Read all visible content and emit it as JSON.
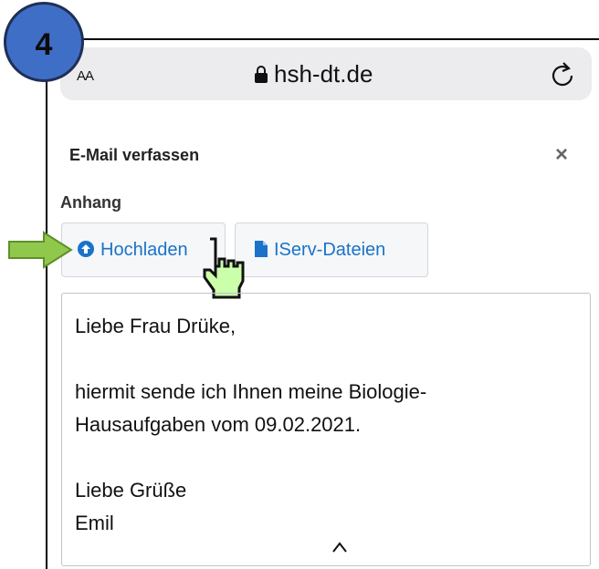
{
  "browser": {
    "aa_label": "AA",
    "url": "hsh-dt.de"
  },
  "step_badge": "4",
  "dialog": {
    "title": "E-Mail verfassen",
    "close_label": "×",
    "attachment_label": "Anhang",
    "upload_button": "Hochladen",
    "iserv_button": "IServ-Dateien"
  },
  "message": {
    "greeting": "Liebe Frau Drüke,",
    "body_line1": "hiermit sende ich Ihnen meine Biologie-",
    "body_line2": "Hausaufgaben vom 09.02.2021.",
    "closing": "Liebe Grüße",
    "signature": "Emil"
  },
  "colors": {
    "accent_blue": "#1a73c9",
    "badge_blue": "#3f6ec6",
    "arrow_green": "#8fc84a",
    "hand_green": "#ccffaa"
  },
  "icons": [
    "lock-icon",
    "reload-icon",
    "upload-circle-icon",
    "file-icon",
    "pointer-hand-icon",
    "green-arrow-icon"
  ]
}
